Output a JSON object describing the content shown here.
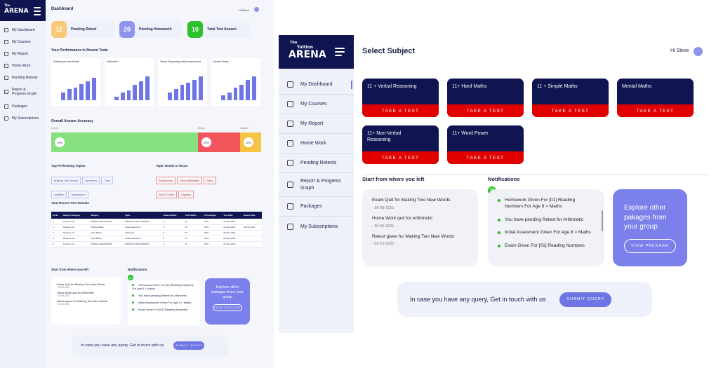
{
  "left": {
    "logo_small": "The",
    "logo": "ARENA",
    "nav": [
      "My Dashboard",
      "My Courses",
      "My Report",
      "Home Work",
      "Pending Retests",
      "Report & Progress Graph",
      "Packages",
      "My Subscriptions"
    ],
    "title": "Dashboard",
    "greeting": "Hi Steve",
    "stats": [
      {
        "value": "12",
        "label": "Pending Retest"
      },
      {
        "value": "20",
        "label": "Pending Homework"
      },
      {
        "value": "10",
        "label": "Total Test Answer"
      }
    ],
    "perf_title": "Your Performance in Recent Tests",
    "charts": [
      {
        "title": "Making two new Words",
        "bars": [
          0.3,
          0.45,
          0.5,
          0.65,
          0.75,
          0.9
        ]
      },
      {
        "title": "Arithmetic",
        "bars": [
          0.15,
          0.3,
          0.4,
          0.6,
          0.75,
          0.95
        ]
      },
      {
        "title": "Verbal Reasoning Initial Assessment",
        "bars": [
          0.3,
          0.45,
          0.6,
          0.7,
          0.8,
          0.95
        ]
      },
      {
        "title": "Mental Maths",
        "bars": [
          0.2,
          0.3,
          0.5,
          0.6,
          0.8,
          0.95
        ]
      }
    ],
    "chart_ylabel": "Percentage",
    "accuracy_title": "Overall Answer Accuracy",
    "acc": {
      "correct_label": "Correct",
      "wrong_label": "Wrong",
      "skipped_label": "Skipped",
      "correct": "70%",
      "wrong": "20%",
      "skipped": "10%"
    },
    "top_title": "Top Performing Topics",
    "top": [
      "Making Two Words",
      "Synonims",
      "Time",
      "Addition",
      "Subtraction"
    ],
    "focus_title": "Topic Needs to focus",
    "focus": [
      "Sequences",
      "Word Arithmetic",
      "Ratio",
      "Word Codes",
      "Algebra"
    ],
    "results_title": "Your Recent Test Results",
    "results_head": [
      "Sr.No",
      "Subject Category",
      "Subject",
      "Topic",
      "Obtain Marks",
      "Total Marks",
      "Percentage",
      "Test Date",
      "Retest Date"
    ],
    "results": [
      [
        "1",
        "Advance 11+",
        "VERBAL REASONING",
        "MAKING 2 NEW WORDS",
        "8",
        "15",
        "95%",
        "29-Sep-2021",
        ""
      ],
      [
        "2",
        "Advance 11+",
        "Simple Maths",
        "Initial Assesment",
        "6",
        "15",
        "95%",
        "29-Sep-2021",
        "06-Oct-2021"
      ],
      [
        "3",
        "Advance 11+",
        "Hard Maths",
        "Arithmetic",
        "8",
        "15",
        "95%",
        "29-Sep-2021",
        ""
      ],
      [
        "4",
        "Advance 11+",
        "Hard Maths",
        "Initial Assesment",
        "8",
        "15",
        "95%",
        "29-Sep-2021",
        ""
      ],
      [
        "5",
        "Advance 11+",
        "VERBAL REASONING",
        "MAKING 2 NEW WORDS",
        "9",
        "15",
        "95%",
        "29-Sep-2021",
        ""
      ]
    ],
    "start_title": "Start from where you left",
    "start": [
      {
        "text": "Exam Quit for Making Two New Words",
        "date": "- 29-09-2021"
      },
      {
        "text": "Home Work quit for Arithmetic",
        "date": "- 30-09-2021"
      },
      {
        "text": "Retest given for Making Two New Words",
        "date": "- 02-10-2021"
      }
    ],
    "notif_title": "Notifications",
    "notif_count": "10",
    "notifs": [
      "Homework Given For [01] Reading Numbers For Age 8 > Maths",
      "You have pending Retest for Arithmetic",
      "Initial Assesment Given For Age 8 > Maths",
      "Exam Given For [01] Reading Numbers"
    ],
    "promo": "Explore other pakages from your group",
    "promo_btn": "VIEW PACKAGE",
    "query": "In case you have any query, Get in touch with us",
    "query_btn": "SUBMIT QUERY"
  },
  "right": {
    "logo_small": "The",
    "logo_mid": "Tuition",
    "logo": "ARENA",
    "nav": [
      "My Dashboard",
      "My Courses",
      "My Report",
      "Home Work",
      "Pending Retests",
      "Report & Progress Graph",
      "Packages",
      "My Subscriptions"
    ],
    "title": "Select Subject",
    "greeting": "Hi Steve",
    "subjects": [
      "11 + Verbal Reasoning",
      "11+ Hard Maths",
      "11 + Simple Maths",
      "Mental Maths",
      "11+ Non-Verbal Reasoning",
      "11+ Word Power"
    ],
    "take_test": "TAKE A TEST",
    "start_title": "Start from where you left",
    "start": [
      {
        "text": "Exam Quit for Making Two New Words",
        "date": "- 29-09-2021"
      },
      {
        "text": "Home Work quit for Arithmetic",
        "date": "- 30-09-2021"
      },
      {
        "text": "Retest given for Making Two New Words",
        "date": "- 02-10-2021"
      }
    ],
    "notif_title": "Notifications",
    "notif_count": "10",
    "notifs": [
      "Homework Given For [01] Reading Numbers For Age 8 > Maths",
      "You have pending Retest for Arithmetic",
      "Initial Assesment Given For Age 8 > Maths",
      "Exam Given For [01] Reading Numbers"
    ],
    "promo": "Explore other pakages from your group",
    "promo_btn": "VIEW PACKAGE",
    "query": "In case you have any query, Get in touch with us",
    "query_btn": "SUBMIT QUERY"
  },
  "colors": {
    "navy": "#0f1550",
    "accent": "#6f75e4",
    "red": "#e00000",
    "green": "#7ee27e",
    "yellow": "#f7c343"
  }
}
